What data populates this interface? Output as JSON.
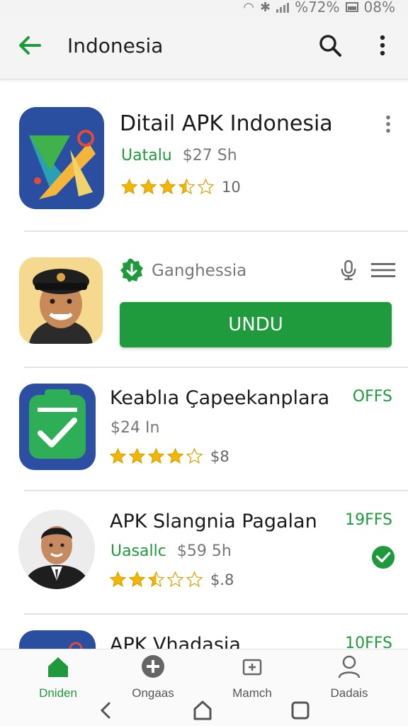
{
  "status_bar": {
    "battery_left": "%72%",
    "battery_right": "08%"
  },
  "app_bar": {
    "title": "Indonesia"
  },
  "items": [
    {
      "name": "Ditail APK Indonesia",
      "developer": "Uatalu",
      "price": "$27 Sh",
      "stars": 3.5,
      "rating": "10"
    },
    {
      "developer": "Ganghessia",
      "install_label": "UNDU"
    },
    {
      "name": "Keablıa Çapeekanplara",
      "price": "$24 In",
      "stars": 4,
      "rating": "$8",
      "tag": "OFFS"
    },
    {
      "name": "APK Slangnia Pagalan",
      "developer": "Uasallc",
      "price": "$59 5h",
      "stars": 2.5,
      "rating": "$.8",
      "tag": "19FFS"
    },
    {
      "name": "APK Vhadasia",
      "tag": "10FFS"
    }
  ],
  "bottom_nav": [
    {
      "label": "Dniden",
      "active": true
    },
    {
      "label": "Ongaas"
    },
    {
      "label": "Mamch"
    },
    {
      "label": "Dadais"
    }
  ],
  "colors": {
    "accent": "#1e9a3c",
    "star": "#f2b705"
  }
}
